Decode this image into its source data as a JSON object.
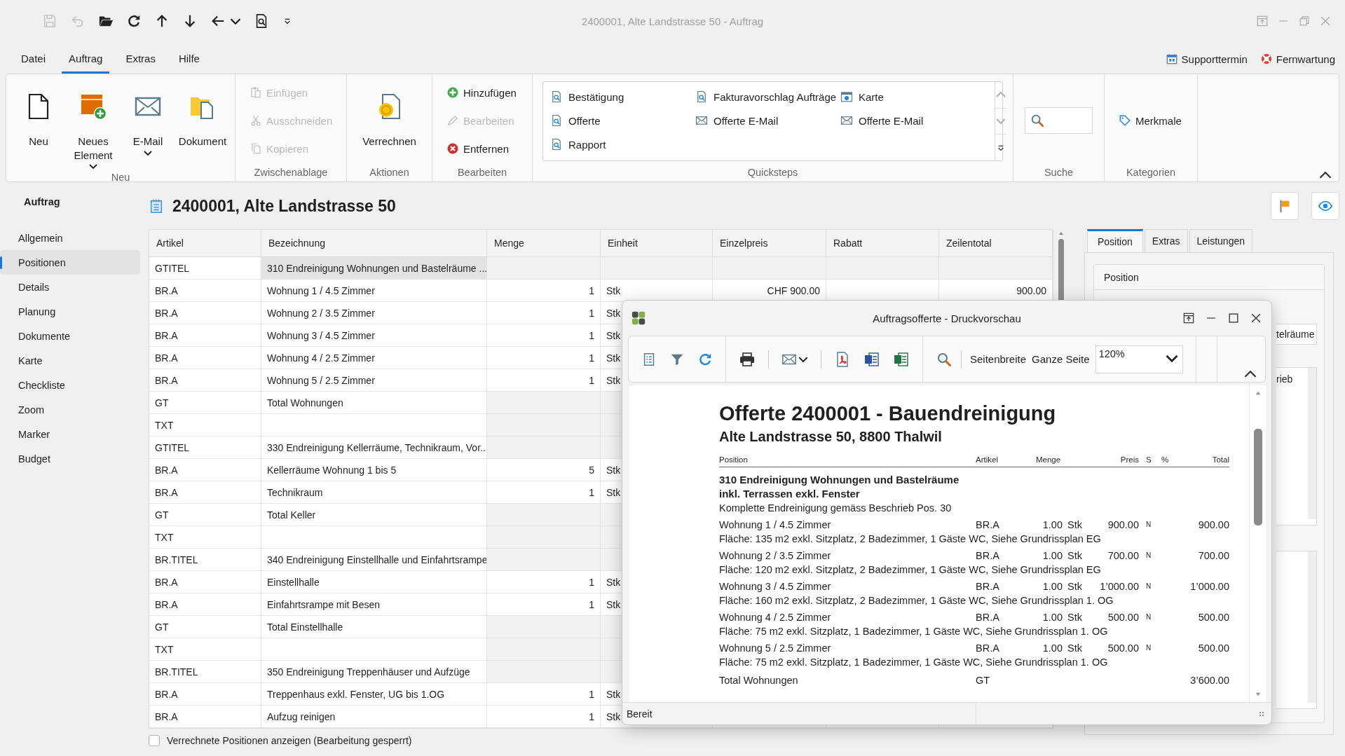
{
  "window": {
    "title": "2400001, Alte Landstrasse 50 - Auftrag"
  },
  "quick_access": [
    {
      "kind": "save",
      "disabled": true
    },
    {
      "kind": "undo",
      "disabled": true
    },
    {
      "kind": "open",
      "disabled": false
    },
    {
      "kind": "refresh",
      "disabled": false
    },
    {
      "kind": "up",
      "disabled": false
    },
    {
      "kind": "down",
      "disabled": false
    },
    {
      "kind": "back",
      "disabled": false
    },
    {
      "kind": "dropdown",
      "disabled": false
    },
    {
      "kind": "preview",
      "disabled": false
    },
    {
      "kind": "customize",
      "disabled": false
    }
  ],
  "menu": {
    "tabs": [
      {
        "label": "Datei",
        "selected": false
      },
      {
        "label": "Auftrag",
        "selected": true
      },
      {
        "label": "Extras",
        "selected": false
      },
      {
        "label": "Hilfe",
        "selected": false
      }
    ],
    "links": [
      {
        "kind": "calendar",
        "label": "Supporttermin"
      },
      {
        "kind": "lifebuoy",
        "label": "Fernwartung"
      }
    ]
  },
  "ribbon": {
    "groups": [
      {
        "label": "Neu",
        "kind": "large",
        "buttons": [
          {
            "kind": "page",
            "label": "Neu",
            "dropdown": false
          },
          {
            "kind": "new-element",
            "label": "Neues Element",
            "dropdown": true
          },
          {
            "kind": "email",
            "label": "E-Mail",
            "dropdown": true
          },
          {
            "kind": "document",
            "label": "Dokument",
            "dropdown": false
          }
        ]
      },
      {
        "label": "Zwischenablage",
        "kind": "small",
        "buttons": [
          {
            "kind": "paste",
            "label": "Einfügen",
            "disabled": true
          },
          {
            "kind": "cut",
            "label": "Ausschneiden",
            "disabled": true
          },
          {
            "kind": "copy",
            "label": "Kopieren",
            "disabled": true
          }
        ]
      },
      {
        "label": "Aktionen",
        "kind": "large",
        "buttons": [
          {
            "kind": "invoice",
            "label": "Verrechnen",
            "dropdown": false
          }
        ]
      },
      {
        "label": "Bearbeiten",
        "kind": "small",
        "buttons": [
          {
            "kind": "add",
            "label": "Hinzufügen",
            "disabled": false
          },
          {
            "kind": "edit",
            "label": "Bearbeiten",
            "disabled": true
          },
          {
            "kind": "remove",
            "label": "Entfernen",
            "disabled": false
          }
        ]
      },
      {
        "label": "Quicksteps",
        "kind": "gallery",
        "items": [
          {
            "kind": "report",
            "label": "Bestätigung"
          },
          {
            "kind": "report",
            "label": "Fakturavorschlag Aufträge"
          },
          {
            "kind": "map",
            "label": "Karte"
          },
          {
            "kind": "report",
            "label": "Offerte"
          },
          {
            "kind": "mail",
            "label": "Offerte E-Mail"
          },
          {
            "kind": "mail",
            "label": "Offerte E-Mail"
          },
          {
            "kind": "report",
            "label": "Rapport"
          }
        ]
      },
      {
        "label": "Suche",
        "kind": "search"
      },
      {
        "label": "Kategorien",
        "kind": "small",
        "buttons": [
          {
            "kind": "tag",
            "label": "Merkmale",
            "disabled": false
          }
        ]
      }
    ]
  },
  "sidebar": {
    "title": "Auftrag",
    "items": [
      {
        "label": "Allgemein",
        "selected": false
      },
      {
        "label": "Positionen",
        "selected": true
      },
      {
        "label": "Details",
        "selected": false
      },
      {
        "label": "Planung",
        "selected": false
      },
      {
        "label": "Dokumente",
        "selected": false
      },
      {
        "label": "Karte",
        "selected": false
      },
      {
        "label": "Checkliste",
        "selected": false
      },
      {
        "label": "Zoom",
        "selected": false
      },
      {
        "label": "Marker",
        "selected": false
      },
      {
        "label": "Budget",
        "selected": false
      }
    ]
  },
  "document": {
    "title": "2400001, Alte Landstrasse 50"
  },
  "table": {
    "columns": [
      "Artikel",
      "Bezeichnung",
      "Menge",
      "Einheit",
      "Einzelpreis",
      "Rabatt",
      "Zeilentotal"
    ],
    "rows": [
      {
        "kind": "title",
        "artikel": "GTITEL",
        "bezeichnung": "310 Endreinigung Wohnungen und Bastelräume ...",
        "selected": true
      },
      {
        "kind": "item",
        "artikel": "BR.A",
        "bezeichnung": "Wohnung 1 / 4.5 Zimmer",
        "menge": "1",
        "einheit": "Stk",
        "einzelpreis": "CHF 900.00",
        "zeilentotal": "900.00",
        "selected": false
      },
      {
        "kind": "item",
        "artikel": "BR.A",
        "bezeichnung": "Wohnung 2 / 3.5 Zimmer",
        "menge": "1",
        "einheit": "Stk",
        "selected": false
      },
      {
        "kind": "item",
        "artikel": "BR.A",
        "bezeichnung": "Wohnung 3 / 4.5 Zimmer",
        "menge": "1",
        "einheit": "Stk",
        "selected": false
      },
      {
        "kind": "item",
        "artikel": "BR.A",
        "bezeichnung": "Wohnung 4 / 2.5 Zimmer",
        "menge": "1",
        "einheit": "Stk",
        "selected": false
      },
      {
        "kind": "item",
        "artikel": "BR.A",
        "bezeichnung": "Wohnung 5 / 2.5 Zimmer",
        "menge": "1",
        "einheit": "Stk",
        "selected": false
      },
      {
        "kind": "total",
        "artikel": "GT",
        "bezeichnung": "Total Wohnungen",
        "selected": false
      },
      {
        "kind": "text",
        "artikel": "TXT",
        "selected": false
      },
      {
        "kind": "title",
        "artikel": "GTITEL",
        "bezeichnung": "330 Endreinigung Kellerräume, Technikraum, Vor...",
        "selected": false
      },
      {
        "kind": "item",
        "artikel": "BR.A",
        "bezeichnung": "Kellerräume Wohnung 1 bis 5",
        "menge": "5",
        "einheit": "Stk",
        "selected": false
      },
      {
        "kind": "item",
        "artikel": "BR.A",
        "bezeichnung": "Technikraum",
        "menge": "1",
        "einheit": "Stk",
        "selected": false
      },
      {
        "kind": "total",
        "artikel": "GT",
        "bezeichnung": "Total Keller",
        "selected": false
      },
      {
        "kind": "text",
        "artikel": "TXT",
        "selected": false
      },
      {
        "kind": "title",
        "artikel": "BR.TITEL",
        "bezeichnung": "340 Endreinigung Einstellhalle und Einfahrtsrampe",
        "selected": false
      },
      {
        "kind": "item",
        "artikel": "BR.A",
        "bezeichnung": "Einstellhalle",
        "menge": "1",
        "einheit": "Stk",
        "selected": false
      },
      {
        "kind": "item",
        "artikel": "BR.A",
        "bezeichnung": "Einfahrtsrampe mit Besen",
        "menge": "1",
        "einheit": "Stk",
        "selected": false
      },
      {
        "kind": "total",
        "artikel": "GT",
        "bezeichnung": "Total Einstellhalle",
        "selected": false
      },
      {
        "kind": "text",
        "artikel": "TXT",
        "selected": false
      },
      {
        "kind": "title",
        "artikel": "BR.TITEL",
        "bezeichnung": "350 Endreinigung Treppenhäuser und Aufzüge",
        "selected": false
      },
      {
        "kind": "item",
        "artikel": "BR.A",
        "bezeichnung": "Treppenhaus exkl. Fenster, UG bis 1.OG",
        "menge": "1",
        "einheit": "Stk",
        "selected": false
      },
      {
        "kind": "item",
        "artikel": "BR.A",
        "bezeichnung": "Aufzug reinigen",
        "menge": "1",
        "einheit": "Stk",
        "selected": false
      }
    ]
  },
  "show_billed": {
    "label": "Verrechnete Positionen anzeigen (Bearbeitung gesperrt)",
    "checked": false
  },
  "right_panel": {
    "tabs": [
      {
        "label": "Position",
        "selected": true
      },
      {
        "label": "Extras",
        "selected": false
      },
      {
        "label": "Leistungen",
        "selected": false
      }
    ],
    "group_title": "Position",
    "fields": [
      {
        "kind": "input",
        "value": "telräume"
      },
      {
        "kind": "textarea",
        "value": "rieb"
      },
      {
        "kind": "textarea"
      }
    ]
  },
  "preview_dialog": {
    "title": "Auftragsofferte - Druckvorschau",
    "zoom_buttons": [
      "Seitenbreite",
      "Ganze Seite"
    ],
    "zoom_value": "120%",
    "report": {
      "title": "Offerte 2400001 - Bauendreinigung",
      "subtitle": "Alte Landstrasse 50, 8800 Thalwil",
      "columns": [
        "Position",
        "Artikel",
        "Menge",
        "Preis",
        "S",
        "%",
        "Total"
      ],
      "heading": [
        "310 Endreinigung Wohnungen und Bastelräume",
        "inkl. Terrassen exkl. Fenster"
      ],
      "description": "Komplette Endreinigung gemäss Beschrieb Pos. 30",
      "items": [
        {
          "position": "Wohnung 1 / 4.5 Zimmer",
          "artikel": "BR.A",
          "menge": "1.00",
          "einheit": "Stk",
          "preis": "900.00",
          "s": "N",
          "total": "900.00",
          "detail": "Fläche: 135 m2 exkl. Sitzplatz, 2 Badezimmer, 1 Gäste WC, Siehe Grundrissplan EG"
        },
        {
          "position": "Wohnung 2 / 3.5 Zimmer",
          "artikel": "BR.A",
          "menge": "1.00",
          "einheit": "Stk",
          "preis": "700.00",
          "s": "N",
          "total": "700.00",
          "detail": "Fläche: 120 m2 exkl. Sitzplatz, 2 Badezimmer, 1 Gäste WC, Siehe Grundrissplan EG"
        },
        {
          "position": "Wohnung 3 / 4.5 Zimmer",
          "artikel": "BR.A",
          "menge": "1.00",
          "einheit": "Stk",
          "preis": "1’000.00",
          "s": "N",
          "total": "1’000.00",
          "detail": "Fläche: 160 m2 exkl. Sitzplatz, 2 Badezimmer, 1 Gäste WC, Siehe Grundrissplan 1. OG"
        },
        {
          "position": "Wohnung 4 / 2.5 Zimmer",
          "artikel": "BR.A",
          "menge": "1.00",
          "einheit": "Stk",
          "preis": "500.00",
          "s": "N",
          "total": "500.00",
          "detail": "Fläche: 75 m2 exkl. Sitzplatz, 1 Badezimmer, 1 Gäste WC, Siehe Grundrissplan 1. OG"
        },
        {
          "position": "Wohnung 5 / 2.5 Zimmer",
          "artikel": "BR.A",
          "menge": "1.00",
          "einheit": "Stk",
          "preis": "500.00",
          "s": "N",
          "total": "500.00",
          "detail": "Fläche: 75 m2 exkl. Sitzplatz, 1 Badezimmer, 1 Gäste WC, Siehe Grundrissplan 1. OG"
        }
      ],
      "total": {
        "position": "Total Wohnungen",
        "artikel": "GT",
        "total": "3’600.00"
      }
    },
    "status": "Bereit"
  }
}
